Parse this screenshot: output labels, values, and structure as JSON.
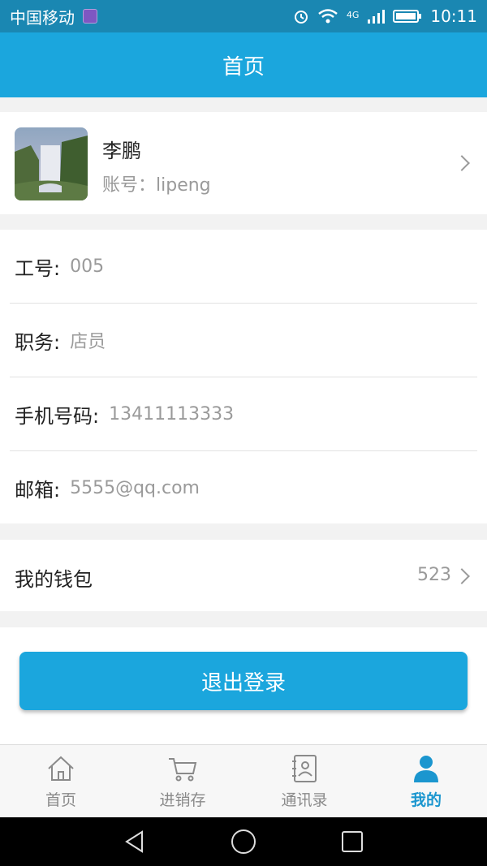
{
  "status_bar": {
    "carrier": "中国移动",
    "network": "4G",
    "time": "10:11"
  },
  "header": {
    "title": "首页"
  },
  "profile": {
    "name": "李鹏",
    "account": "账号：lipeng"
  },
  "info": [
    {
      "label": "工号:",
      "value": "005"
    },
    {
      "label": "职务:",
      "value": "店员"
    },
    {
      "label": "手机号码:",
      "value": "13411113333"
    },
    {
      "label": "邮箱:",
      "value": "5555@qq.com"
    }
  ],
  "wallet": {
    "label": "我的钱包",
    "value": "523"
  },
  "logout": {
    "label": "退出登录"
  },
  "tabs": [
    {
      "label": "首页",
      "icon": "home-icon",
      "active": false
    },
    {
      "label": "进销存",
      "icon": "cart-icon",
      "active": false
    },
    {
      "label": "通讯录",
      "icon": "contacts-icon",
      "active": false
    },
    {
      "label": "我的",
      "icon": "person-icon",
      "active": true
    }
  ],
  "colors": {
    "accent": "#1ba6dd",
    "status_bar": "#1a87b2",
    "active_tab": "#1b96cf"
  }
}
